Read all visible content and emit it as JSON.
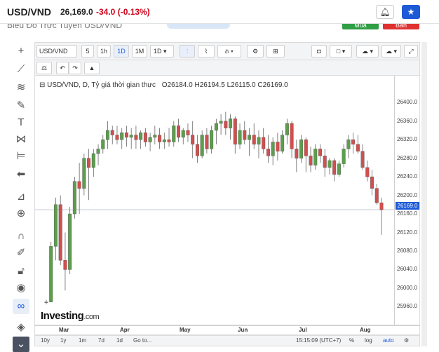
{
  "header": {
    "ticker": "USD/VND",
    "price": "26,169.0",
    "change": "-34.0",
    "change_pct": "(-0.13%)",
    "ghost_text": "Biểu Đồ Trực Tuyến USD/VND",
    "buy_label": "Mua",
    "sell_label": "Bán"
  },
  "toolbar": {
    "symbol": "USD/VND",
    "intervals": [
      "5",
      "1h",
      "1D",
      "1M",
      "1D"
    ],
    "selected_interval": "1D"
  },
  "legend": {
    "title": "USD/VND, D, Tỷ giá thời gian thực",
    "open": "O26184.0",
    "high": "H26194.5",
    "low": "L26115.0",
    "close": "C26169.0"
  },
  "y_ticks": [
    "26400.0",
    "26360.0",
    "26320.0",
    "26280.0",
    "26240.0",
    "26200.0",
    "26160.0",
    "26120.0",
    "26080.0",
    "26040.0",
    "26000.0",
    "25960.0"
  ],
  "price_tag": "26169.0",
  "x_ticks": [
    "Mar",
    "Apr",
    "May",
    "Jun",
    "Jul",
    "Aug"
  ],
  "logo": {
    "main": "Investing",
    "dom": ".com"
  },
  "bottom": {
    "ranges": [
      "10y",
      "1y",
      "1m",
      "7d",
      "1d",
      "Go to..."
    ],
    "time": "15:15:09 (UTC+7)",
    "pct": "%",
    "log": "log",
    "auto": "auto"
  },
  "colors": {
    "up": "#5c9e4c",
    "down": "#d14f4f",
    "accent": "#1e5ad6"
  },
  "chart_data": {
    "type": "candlestick",
    "ylim": [
      25950,
      26420
    ],
    "candles": [
      {
        "o": 25970,
        "h": 25975,
        "l": 25965,
        "c": 25970
      },
      {
        "o": 25970,
        "h": 26100,
        "l": 25970,
        "c": 26090
      },
      {
        "o": 26090,
        "h": 26195,
        "l": 26060,
        "c": 26180
      },
      {
        "o": 26180,
        "h": 26200,
        "l": 26050,
        "c": 26060
      },
      {
        "o": 26060,
        "h": 26120,
        "l": 25995,
        "c": 26040
      },
      {
        "o": 26040,
        "h": 26175,
        "l": 26030,
        "c": 26160
      },
      {
        "o": 26160,
        "h": 26240,
        "l": 26150,
        "c": 26230
      },
      {
        "o": 26230,
        "h": 26270,
        "l": 26160,
        "c": 26215
      },
      {
        "o": 26215,
        "h": 26290,
        "l": 26200,
        "c": 26280
      },
      {
        "o": 26280,
        "h": 26300,
        "l": 26190,
        "c": 26260
      },
      {
        "o": 26260,
        "h": 26300,
        "l": 26240,
        "c": 26290
      },
      {
        "o": 26290,
        "h": 26310,
        "l": 26265,
        "c": 26300
      },
      {
        "o": 26300,
        "h": 26330,
        "l": 26290,
        "c": 26320
      },
      {
        "o": 26320,
        "h": 26360,
        "l": 26300,
        "c": 26340
      },
      {
        "o": 26340,
        "h": 26350,
        "l": 26310,
        "c": 26330
      },
      {
        "o": 26330,
        "h": 26350,
        "l": 26310,
        "c": 26320
      },
      {
        "o": 26320,
        "h": 26345,
        "l": 26300,
        "c": 26335
      },
      {
        "o": 26335,
        "h": 26350,
        "l": 26305,
        "c": 26325
      },
      {
        "o": 26325,
        "h": 26345,
        "l": 26300,
        "c": 26330
      },
      {
        "o": 26330,
        "h": 26350,
        "l": 26300,
        "c": 26320
      },
      {
        "o": 26320,
        "h": 26340,
        "l": 26300,
        "c": 26335
      },
      {
        "o": 26335,
        "h": 26345,
        "l": 26305,
        "c": 26315
      },
      {
        "o": 26315,
        "h": 26335,
        "l": 26295,
        "c": 26325
      },
      {
        "o": 26325,
        "h": 26350,
        "l": 26310,
        "c": 26330
      },
      {
        "o": 26330,
        "h": 26345,
        "l": 26300,
        "c": 26315
      },
      {
        "o": 26315,
        "h": 26335,
        "l": 26300,
        "c": 26320
      },
      {
        "o": 26320,
        "h": 26345,
        "l": 26305,
        "c": 26315
      },
      {
        "o": 26315,
        "h": 26360,
        "l": 26305,
        "c": 26350
      },
      {
        "o": 26350,
        "h": 26365,
        "l": 26315,
        "c": 26325
      },
      {
        "o": 26325,
        "h": 26345,
        "l": 26310,
        "c": 26340
      },
      {
        "o": 26340,
        "h": 26355,
        "l": 26315,
        "c": 26330
      },
      {
        "o": 26330,
        "h": 26360,
        "l": 26280,
        "c": 26310
      },
      {
        "o": 26310,
        "h": 26330,
        "l": 26270,
        "c": 26285
      },
      {
        "o": 26285,
        "h": 26340,
        "l": 26280,
        "c": 26330
      },
      {
        "o": 26330,
        "h": 26345,
        "l": 26290,
        "c": 26300
      },
      {
        "o": 26300,
        "h": 26350,
        "l": 26290,
        "c": 26340
      },
      {
        "o": 26340,
        "h": 26365,
        "l": 26310,
        "c": 26355
      },
      {
        "o": 26355,
        "h": 26375,
        "l": 26330,
        "c": 26360
      },
      {
        "o": 26360,
        "h": 26380,
        "l": 26330,
        "c": 26345
      },
      {
        "o": 26345,
        "h": 26375,
        "l": 26320,
        "c": 26365
      },
      {
        "o": 26365,
        "h": 26370,
        "l": 26290,
        "c": 26310
      },
      {
        "o": 26310,
        "h": 26355,
        "l": 26300,
        "c": 26340
      },
      {
        "o": 26340,
        "h": 26360,
        "l": 26310,
        "c": 26320
      },
      {
        "o": 26320,
        "h": 26345,
        "l": 26285,
        "c": 26330
      },
      {
        "o": 26330,
        "h": 26355,
        "l": 26300,
        "c": 26310
      },
      {
        "o": 26310,
        "h": 26340,
        "l": 26280,
        "c": 26325
      },
      {
        "o": 26325,
        "h": 26345,
        "l": 26290,
        "c": 26300
      },
      {
        "o": 26300,
        "h": 26330,
        "l": 26270,
        "c": 26285
      },
      {
        "o": 26285,
        "h": 26325,
        "l": 26265,
        "c": 26315
      },
      {
        "o": 26315,
        "h": 26335,
        "l": 26275,
        "c": 26295
      },
      {
        "o": 26295,
        "h": 26340,
        "l": 26290,
        "c": 26330
      },
      {
        "o": 26330,
        "h": 26365,
        "l": 26310,
        "c": 26355
      },
      {
        "o": 26355,
        "h": 26360,
        "l": 26280,
        "c": 26300
      },
      {
        "o": 26300,
        "h": 26320,
        "l": 26250,
        "c": 26280
      },
      {
        "o": 26280,
        "h": 26330,
        "l": 26270,
        "c": 26320
      },
      {
        "o": 26320,
        "h": 26325,
        "l": 26250,
        "c": 26285
      },
      {
        "o": 26285,
        "h": 26305,
        "l": 26250,
        "c": 26265
      },
      {
        "o": 26265,
        "h": 26310,
        "l": 26255,
        "c": 26300
      },
      {
        "o": 26300,
        "h": 26310,
        "l": 26270,
        "c": 26285
      },
      {
        "o": 26285,
        "h": 26300,
        "l": 26240,
        "c": 26260
      },
      {
        "o": 26260,
        "h": 26280,
        "l": 26245,
        "c": 26275
      },
      {
        "o": 26275,
        "h": 26280,
        "l": 26230,
        "c": 26245
      },
      {
        "o": 26245,
        "h": 26275,
        "l": 26240,
        "c": 26268
      },
      {
        "o": 26268,
        "h": 26310,
        "l": 26260,
        "c": 26300
      },
      {
        "o": 26300,
        "h": 26330,
        "l": 26280,
        "c": 26320
      },
      {
        "o": 26320,
        "h": 26335,
        "l": 26290,
        "c": 26310
      },
      {
        "o": 26310,
        "h": 26330,
        "l": 26290,
        "c": 26295
      },
      {
        "o": 26295,
        "h": 26310,
        "l": 26255,
        "c": 26260
      },
      {
        "o": 26260,
        "h": 26275,
        "l": 26230,
        "c": 26240
      },
      {
        "o": 26240,
        "h": 26255,
        "l": 26200,
        "c": 26215
      },
      {
        "o": 26215,
        "h": 26225,
        "l": 26180,
        "c": 26184
      },
      {
        "o": 26184,
        "h": 26195,
        "l": 26115,
        "c": 26169
      }
    ]
  }
}
